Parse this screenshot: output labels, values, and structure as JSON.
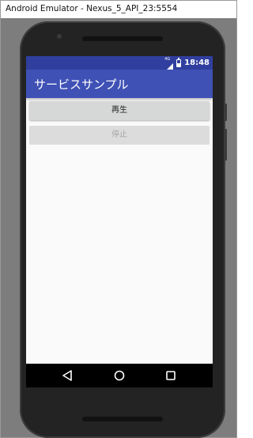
{
  "window": {
    "title": "Android Emulator - Nexus_5_API_23:5554"
  },
  "status_bar": {
    "network": "4G",
    "time": "18:48",
    "color": "#303f9f"
  },
  "app": {
    "title": "サービスサンプル",
    "toolbar_color": "#3f51b5",
    "play_button": {
      "label": "再生",
      "enabled": true
    },
    "stop_button": {
      "label": "停止",
      "enabled": false
    }
  },
  "nav_bar": {
    "icons": [
      "back-icon",
      "home-icon",
      "recent-apps-icon"
    ]
  }
}
